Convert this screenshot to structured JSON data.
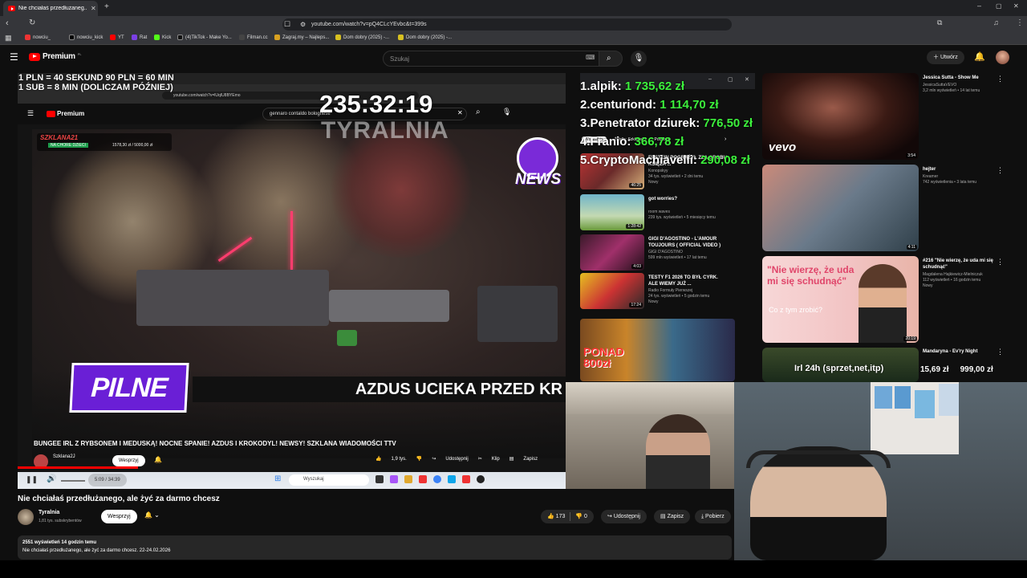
{
  "browser": {
    "tab_title": "Nie chciałaś przedłużaneg...",
    "url": "youtube.com/watch?v=pQ4CLcYEvbc&t=399s",
    "bookmarks": [
      "nowciu_",
      "nowciu_kick",
      "YT",
      "Rat",
      "Kick",
      "(4)TikTok - Make Yo...",
      "Filman.cc",
      "Zagraj.my – Najleps...",
      "Dom dobry (2025) -...",
      "Dom dobry (2025) -..."
    ]
  },
  "header": {
    "logo": "Premium",
    "logo_region": "PL",
    "search_placeholder": "Szukaj",
    "create_label": "Utwórz"
  },
  "stream_overlay": {
    "line1": "1 PLN = 40 SEKUND 90 PLN = 60 MIN",
    "line2": "1 SUB = 8 MIN (DOLICZAM PÓŹNIEJ)",
    "timer": "235:32:19",
    "channel_watermark": "TYRALNIA",
    "donors": [
      {
        "rank": "1.",
        "name": "alpik:",
        "amount": "1 735,62 zł"
      },
      {
        "rank": "2.",
        "name": "centuriond:",
        "amount": "1 114,70 zł"
      },
      {
        "rank": "3.",
        "name": "Penetrator dziurek:",
        "amount": "776,50 zł"
      },
      {
        "rank": "4.",
        "name": "Franio:",
        "amount": "366,78 zł"
      },
      {
        "rank": "5.",
        "name": "CryptoMachiavelli:",
        "amount": "290,08 zł"
      }
    ],
    "goal_text": "Irl 24h (sprzet,net,itp)",
    "goal_current": "15,69 zł",
    "goal_target": "999,00 zł"
  },
  "inner_video": {
    "inner_url": "youtube.com/watch?v=lUqIU8BYEmo",
    "inner_search": "gennaro contaldo bolognese",
    "badge_name": "SZKLANA21",
    "badge_sub": "NA CHORE DZIECI",
    "badge_counter": "1578,30 zł / 5000,00 zł",
    "news_label": "NEWS",
    "pilne": "PILNE",
    "ticker": "AZDUS UCIEKA PRZED KR",
    "inner_title": "BUNGEE IRL Z RYBSONEM I MEDUSKĄ! NOCNE SPANIE! AZDUS I KROKODYL! NEWSY! SZKLANA WIADOMOŚCI TTV",
    "inner_channel": "Szklana2J",
    "inner_join": "Wesprzyj",
    "inner_likes": "1,9 tys.",
    "inner_share": "Udostępnij",
    "inner_clip": "Klip",
    "inner_save": "Zapisz",
    "inner_time": "5:09 / 34:39",
    "inner_taskbar_search": "Wyszukaj"
  },
  "inner_sidebar": {
    "chips": [
      "Wszystkie",
      "Źródło: Szklana2J",
      "Podobne"
    ],
    "videos": [
      {
        "title": "EPSTEIN POGRĄŻYŁ ZZA GROBU KSIĘŻA ...",
        "meta": "Konopskyy\n34 tys. wyświetleń • 2 dni temu\nNowy",
        "duration": "46:25"
      },
      {
        "title": "got worries?",
        "meta": "room waves\n239 tys. wyświetleń • 5 miesięcy temu",
        "duration": "1:28:42"
      },
      {
        "title": "GIGI D'AGOSTINO - L'AMOUR TOUJOURS ( OFFICIAL VIDEO )",
        "meta": "GIGI D'AGOSTINO\n599 mln wyświetleń • 17 lat temu",
        "duration": "4:03"
      },
      {
        "title": "TESTY F1 2026 TO BYŁ CYRK. ALE WIEMY JUŻ ...",
        "meta": "Radio Formuły Pierwszej\n24 tys. wyświetleń • 5 godzin temu\nNowy",
        "duration": "17:24"
      }
    ],
    "promo": "PONAD 800zł"
  },
  "right_column": {
    "videos": [
      {
        "title": "Jessica Sutta - Show Me",
        "meta": "JessicaSuttaVEVO\n3,2 mln wyświetleń • 14 lat temu",
        "duration": "3:54",
        "brand": "vevo"
      },
      {
        "title": "hejter",
        "meta": "Kreamer\n742 wyświetlenia • 3 lata temu",
        "duration": "4:11"
      },
      {
        "title": "#216 \"Nie wierzę, że uda mi się schudnąć\"",
        "meta": "Magdalena Hajkiewicz-Mielniczuk\n112 wyświetleń • 16 godzin temu\nNowy",
        "duration": "20:19",
        "quote": "\"Nie wierzę, że uda mi się schudnąć\"",
        "quote_sub": "Co z tym zrobić?"
      },
      {
        "title": "Mandaryna - Ev'ry Night",
        "meta": "",
        "duration": ""
      }
    ]
  },
  "video": {
    "title": "Nie chciałaś przedłużanego, ale żyć za darmo chcesz",
    "channel": "Tyralnia",
    "subscribers": "1,81 tys. subskrybentów",
    "join_label": "Wesprzyj",
    "likes": "173",
    "dislikes": "0",
    "share_label": "Udostępnij",
    "save_label": "Zapisz",
    "download_label": "Pobierz",
    "views_line": "2551 wyświetleń  14 godzin temu",
    "description": "Nie chciałaś przedłużanego, ale żyć za darmo chcesz. 22-24.02.2026"
  },
  "colors": {
    "accent": "#ff0000",
    "donor_amount": "#3cf03c",
    "pilne_bg": "#6a1fd6"
  }
}
